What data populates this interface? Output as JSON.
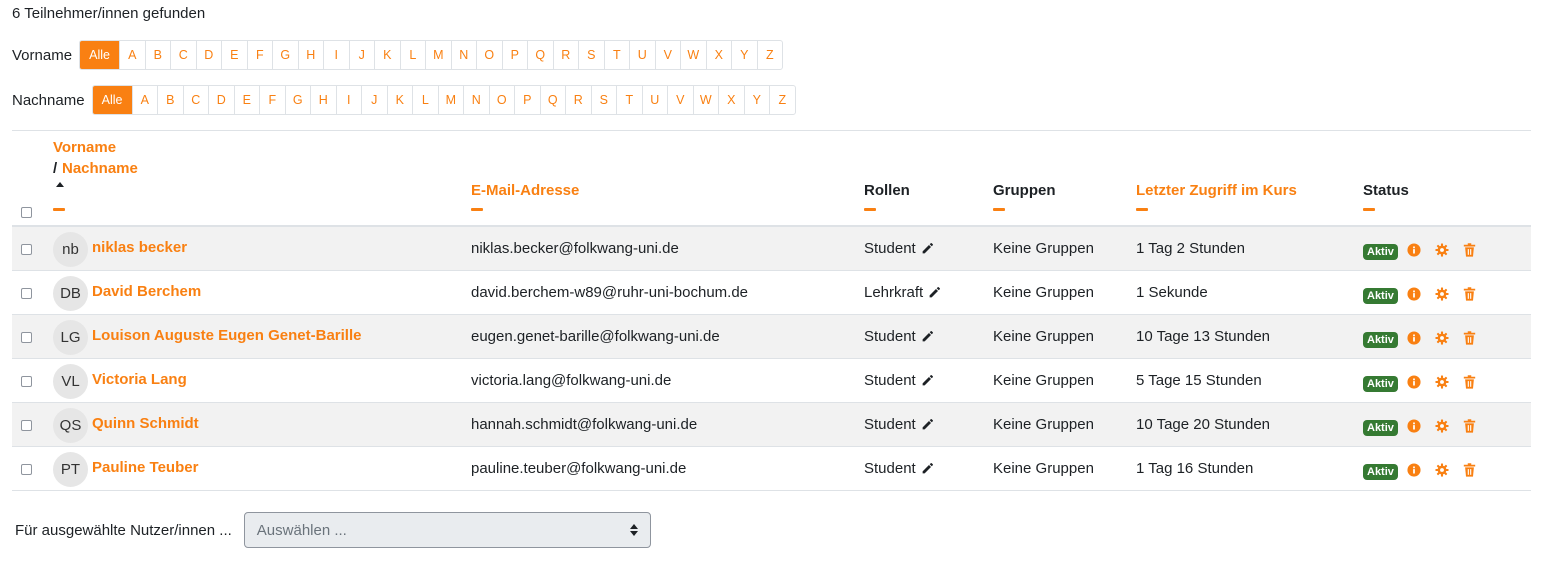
{
  "participants_count": "6 Teilnehmer/innen gefunden",
  "filters": {
    "firstname": {
      "label": "Vorname",
      "letters": [
        "Alle",
        "A",
        "B",
        "C",
        "D",
        "E",
        "F",
        "G",
        "H",
        "I",
        "J",
        "K",
        "L",
        "M",
        "N",
        "O",
        "P",
        "Q",
        "R",
        "S",
        "T",
        "U",
        "V",
        "W",
        "X",
        "Y",
        "Z"
      ],
      "active": "Alle"
    },
    "lastname": {
      "label": "Nachname",
      "letters": [
        "Alle",
        "A",
        "B",
        "C",
        "D",
        "E",
        "F",
        "G",
        "H",
        "I",
        "J",
        "K",
        "L",
        "M",
        "N",
        "O",
        "P",
        "Q",
        "R",
        "S",
        "T",
        "U",
        "V",
        "W",
        "X",
        "Y",
        "Z"
      ],
      "active": "Alle"
    }
  },
  "table": {
    "headers": {
      "firstname": "Vorname",
      "separator": "/",
      "lastname": "Nachname",
      "email": "E-Mail-Adresse",
      "roles": "Rollen",
      "groups": "Gruppen",
      "last_access": "Letzter Zugriff im Kurs",
      "status": "Status"
    },
    "rows": [
      {
        "initials": "nb",
        "name": "niklas becker",
        "email": "niklas.becker@folkwang-uni.de",
        "role": "Student",
        "groups": "Keine Gruppen",
        "last_access": "1 Tag 2 Stunden",
        "status": "Aktiv"
      },
      {
        "initials": "DB",
        "name": "David Berchem",
        "email": "david.berchem-w89@ruhr-uni-bochum.de",
        "role": "Lehrkraft",
        "groups": "Keine Gruppen",
        "last_access": "1 Sekunde",
        "status": "Aktiv"
      },
      {
        "initials": "LG",
        "name": "Louison Auguste Eugen Genet-Barille",
        "email": "eugen.genet-barille@folkwang-uni.de",
        "role": "Student",
        "groups": "Keine Gruppen",
        "last_access": "10 Tage 13 Stunden",
        "status": "Aktiv"
      },
      {
        "initials": "VL",
        "name": "Victoria Lang",
        "email": "victoria.lang@folkwang-uni.de",
        "role": "Student",
        "groups": "Keine Gruppen",
        "last_access": "5 Tage 15 Stunden",
        "status": "Aktiv"
      },
      {
        "initials": "QS",
        "name": "Quinn Schmidt",
        "email": "hannah.schmidt@folkwang-uni.de",
        "role": "Student",
        "groups": "Keine Gruppen",
        "last_access": "10 Tage 20 Stunden",
        "status": "Aktiv"
      },
      {
        "initials": "PT",
        "name": "Pauline Teuber",
        "email": "pauline.teuber@folkwang-uni.de",
        "role": "Student",
        "groups": "Keine Gruppen",
        "last_access": "1 Tag 16 Stunden",
        "status": "Aktiv"
      }
    ]
  },
  "bulk_action": {
    "label": "Für ausgewählte Nutzer/innen ...",
    "placeholder": "Auswählen ..."
  },
  "icons": {
    "role_edit": "pencil-icon",
    "status_info": "info-icon",
    "status_settings": "gear-icon",
    "status_delete": "trash-icon"
  },
  "colors": {
    "accent": "#f98012",
    "badge_active": "#357a32",
    "row_stripe": "#f2f2f2"
  }
}
